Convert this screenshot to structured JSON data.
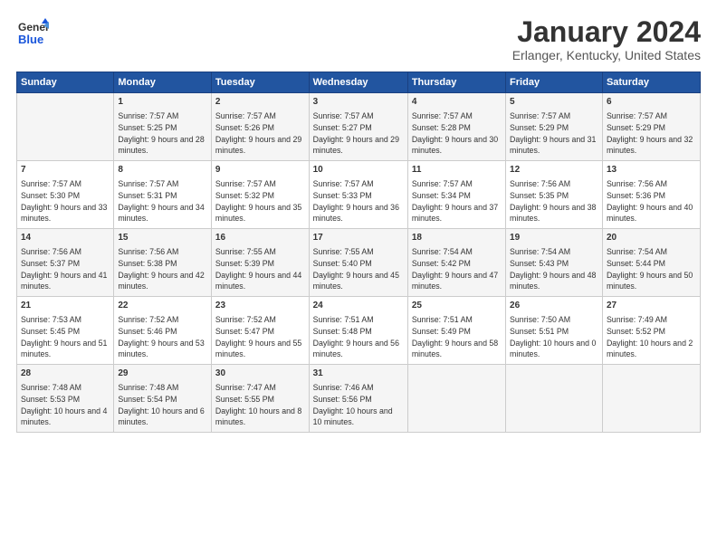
{
  "logo": {
    "line1": "General",
    "line2": "Blue"
  },
  "title": "January 2024",
  "location": "Erlanger, Kentucky, United States",
  "days_header": [
    "Sunday",
    "Monday",
    "Tuesday",
    "Wednesday",
    "Thursday",
    "Friday",
    "Saturday"
  ],
  "weeks": [
    [
      {
        "num": "",
        "sunrise": "",
        "sunset": "",
        "daylight": ""
      },
      {
        "num": "1",
        "sunrise": "Sunrise: 7:57 AM",
        "sunset": "Sunset: 5:25 PM",
        "daylight": "Daylight: 9 hours and 28 minutes."
      },
      {
        "num": "2",
        "sunrise": "Sunrise: 7:57 AM",
        "sunset": "Sunset: 5:26 PM",
        "daylight": "Daylight: 9 hours and 29 minutes."
      },
      {
        "num": "3",
        "sunrise": "Sunrise: 7:57 AM",
        "sunset": "Sunset: 5:27 PM",
        "daylight": "Daylight: 9 hours and 29 minutes."
      },
      {
        "num": "4",
        "sunrise": "Sunrise: 7:57 AM",
        "sunset": "Sunset: 5:28 PM",
        "daylight": "Daylight: 9 hours and 30 minutes."
      },
      {
        "num": "5",
        "sunrise": "Sunrise: 7:57 AM",
        "sunset": "Sunset: 5:29 PM",
        "daylight": "Daylight: 9 hours and 31 minutes."
      },
      {
        "num": "6",
        "sunrise": "Sunrise: 7:57 AM",
        "sunset": "Sunset: 5:29 PM",
        "daylight": "Daylight: 9 hours and 32 minutes."
      }
    ],
    [
      {
        "num": "7",
        "sunrise": "Sunrise: 7:57 AM",
        "sunset": "Sunset: 5:30 PM",
        "daylight": "Daylight: 9 hours and 33 minutes."
      },
      {
        "num": "8",
        "sunrise": "Sunrise: 7:57 AM",
        "sunset": "Sunset: 5:31 PM",
        "daylight": "Daylight: 9 hours and 34 minutes."
      },
      {
        "num": "9",
        "sunrise": "Sunrise: 7:57 AM",
        "sunset": "Sunset: 5:32 PM",
        "daylight": "Daylight: 9 hours and 35 minutes."
      },
      {
        "num": "10",
        "sunrise": "Sunrise: 7:57 AM",
        "sunset": "Sunset: 5:33 PM",
        "daylight": "Daylight: 9 hours and 36 minutes."
      },
      {
        "num": "11",
        "sunrise": "Sunrise: 7:57 AM",
        "sunset": "Sunset: 5:34 PM",
        "daylight": "Daylight: 9 hours and 37 minutes."
      },
      {
        "num": "12",
        "sunrise": "Sunrise: 7:56 AM",
        "sunset": "Sunset: 5:35 PM",
        "daylight": "Daylight: 9 hours and 38 minutes."
      },
      {
        "num": "13",
        "sunrise": "Sunrise: 7:56 AM",
        "sunset": "Sunset: 5:36 PM",
        "daylight": "Daylight: 9 hours and 40 minutes."
      }
    ],
    [
      {
        "num": "14",
        "sunrise": "Sunrise: 7:56 AM",
        "sunset": "Sunset: 5:37 PM",
        "daylight": "Daylight: 9 hours and 41 minutes."
      },
      {
        "num": "15",
        "sunrise": "Sunrise: 7:56 AM",
        "sunset": "Sunset: 5:38 PM",
        "daylight": "Daylight: 9 hours and 42 minutes."
      },
      {
        "num": "16",
        "sunrise": "Sunrise: 7:55 AM",
        "sunset": "Sunset: 5:39 PM",
        "daylight": "Daylight: 9 hours and 44 minutes."
      },
      {
        "num": "17",
        "sunrise": "Sunrise: 7:55 AM",
        "sunset": "Sunset: 5:40 PM",
        "daylight": "Daylight: 9 hours and 45 minutes."
      },
      {
        "num": "18",
        "sunrise": "Sunrise: 7:54 AM",
        "sunset": "Sunset: 5:42 PM",
        "daylight": "Daylight: 9 hours and 47 minutes."
      },
      {
        "num": "19",
        "sunrise": "Sunrise: 7:54 AM",
        "sunset": "Sunset: 5:43 PM",
        "daylight": "Daylight: 9 hours and 48 minutes."
      },
      {
        "num": "20",
        "sunrise": "Sunrise: 7:54 AM",
        "sunset": "Sunset: 5:44 PM",
        "daylight": "Daylight: 9 hours and 50 minutes."
      }
    ],
    [
      {
        "num": "21",
        "sunrise": "Sunrise: 7:53 AM",
        "sunset": "Sunset: 5:45 PM",
        "daylight": "Daylight: 9 hours and 51 minutes."
      },
      {
        "num": "22",
        "sunrise": "Sunrise: 7:52 AM",
        "sunset": "Sunset: 5:46 PM",
        "daylight": "Daylight: 9 hours and 53 minutes."
      },
      {
        "num": "23",
        "sunrise": "Sunrise: 7:52 AM",
        "sunset": "Sunset: 5:47 PM",
        "daylight": "Daylight: 9 hours and 55 minutes."
      },
      {
        "num": "24",
        "sunrise": "Sunrise: 7:51 AM",
        "sunset": "Sunset: 5:48 PM",
        "daylight": "Daylight: 9 hours and 56 minutes."
      },
      {
        "num": "25",
        "sunrise": "Sunrise: 7:51 AM",
        "sunset": "Sunset: 5:49 PM",
        "daylight": "Daylight: 9 hours and 58 minutes."
      },
      {
        "num": "26",
        "sunrise": "Sunrise: 7:50 AM",
        "sunset": "Sunset: 5:51 PM",
        "daylight": "Daylight: 10 hours and 0 minutes."
      },
      {
        "num": "27",
        "sunrise": "Sunrise: 7:49 AM",
        "sunset": "Sunset: 5:52 PM",
        "daylight": "Daylight: 10 hours and 2 minutes."
      }
    ],
    [
      {
        "num": "28",
        "sunrise": "Sunrise: 7:48 AM",
        "sunset": "Sunset: 5:53 PM",
        "daylight": "Daylight: 10 hours and 4 minutes."
      },
      {
        "num": "29",
        "sunrise": "Sunrise: 7:48 AM",
        "sunset": "Sunset: 5:54 PM",
        "daylight": "Daylight: 10 hours and 6 minutes."
      },
      {
        "num": "30",
        "sunrise": "Sunrise: 7:47 AM",
        "sunset": "Sunset: 5:55 PM",
        "daylight": "Daylight: 10 hours and 8 minutes."
      },
      {
        "num": "31",
        "sunrise": "Sunrise: 7:46 AM",
        "sunset": "Sunset: 5:56 PM",
        "daylight": "Daylight: 10 hours and 10 minutes."
      },
      {
        "num": "",
        "sunrise": "",
        "sunset": "",
        "daylight": ""
      },
      {
        "num": "",
        "sunrise": "",
        "sunset": "",
        "daylight": ""
      },
      {
        "num": "",
        "sunrise": "",
        "sunset": "",
        "daylight": ""
      }
    ]
  ]
}
